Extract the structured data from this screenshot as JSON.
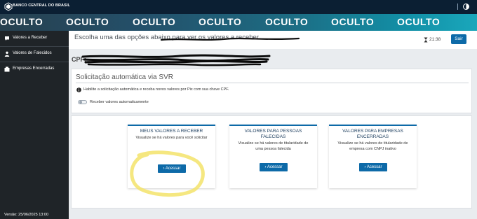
{
  "topbar": {
    "brand": "BANCO CENTRAL DO BRASIL",
    "logo_icon": "bcb-logo-icon",
    "contrast_icon": "contrast-icon"
  },
  "overlay": {
    "words": [
      "OCULTO",
      "OCULTO",
      "OCULTO",
      "OCULTO",
      "OCULTO",
      "OCULTO",
      "OCULTO"
    ]
  },
  "sidebar": {
    "items": [
      {
        "label": "Valores a Receber",
        "icon": "chat-icon"
      },
      {
        "label": "Valores de Falecidos",
        "icon": "person-icon"
      },
      {
        "label": "Empresas Encerradas",
        "icon": "building-icon"
      }
    ],
    "version": "Versão:  25/06/2025 13:00"
  },
  "header": {
    "title": "Escolha uma das opções abaixo para ver os valores a receber",
    "timer": "21:38",
    "timer_icon": "hourglass-icon",
    "logout_label": "Sair"
  },
  "cpf": {
    "label": "CPF:"
  },
  "svr": {
    "title": "Solicitação automática via SVR",
    "info_icon": "info-icon",
    "info_text": "Habilite a solicitação automática e receba novos valores por Pix com sua chave CPF.",
    "toggle_label": "Receber valores automaticamente",
    "toggle_on": false
  },
  "cards": [
    {
      "title": "MEUS VALORES A RECEBER",
      "desc": "Visualize se há valores para você solicitar",
      "button": "Acessar"
    },
    {
      "title": "VALORES PARA PESSOAS FALECIDAS",
      "desc": "Visualize se há valores de titularidade de uma pessoa falecida",
      "button": "Acessar"
    },
    {
      "title": "VALORES PARA EMPRESAS ENCERRADAS",
      "desc": "Visualize se há valores de titularidade de empresa com CNPJ inativo",
      "button": "Acessar"
    }
  ],
  "colors": {
    "topbar": "#0b1f33",
    "sidebar": "#1f2428",
    "primary": "#0d6aa8",
    "highlight": "#f3e36a"
  }
}
